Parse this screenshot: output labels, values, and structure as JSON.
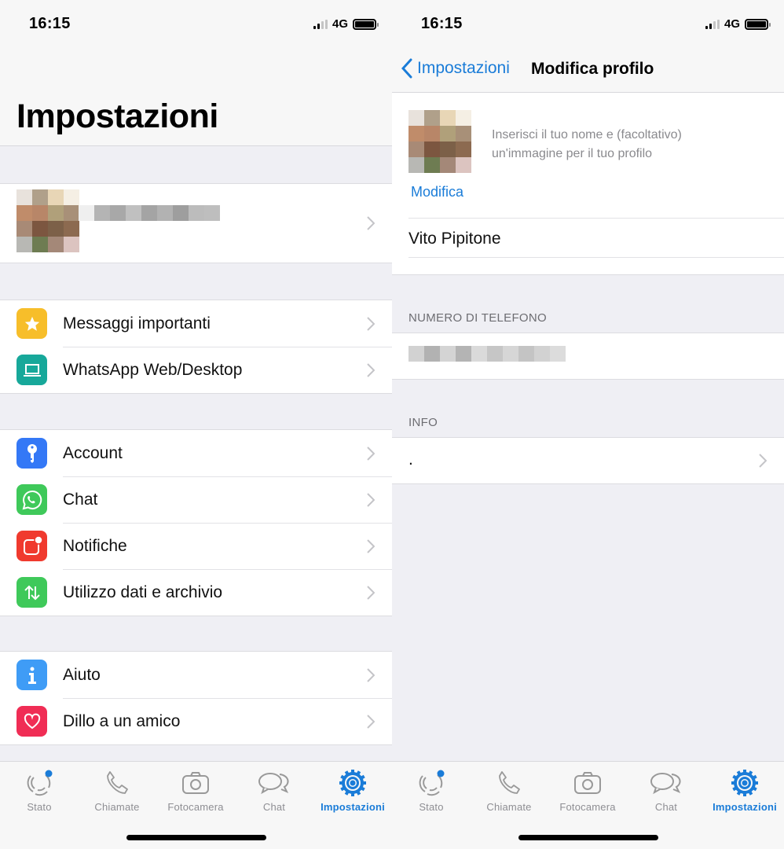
{
  "status_bar": {
    "time": "16:15",
    "network": "4G",
    "signal_bars_active": 2,
    "signal_bars_total": 4,
    "battery_level": 1.0
  },
  "left_screen": {
    "title": "Impostazioni",
    "profile": {
      "avatar": "pixelated-avatar",
      "name": "pixelated-name",
      "chevron": "chevron-right-icon"
    },
    "groups": [
      [
        {
          "label": "Messaggi importanti",
          "icon": "star-icon",
          "color": "#f7be2a"
        },
        {
          "label": "WhatsApp Web/Desktop",
          "icon": "laptop-icon",
          "color": "#17a89a"
        }
      ],
      [
        {
          "label": "Account",
          "icon": "key-icon",
          "color": "#3478f6"
        },
        {
          "label": "Chat",
          "icon": "whatsapp-icon",
          "color": "#3fc95a"
        },
        {
          "label": "Notifiche",
          "icon": "notification-icon",
          "color": "#f03a2e"
        },
        {
          "label": "Utilizzo dati e archivio",
          "icon": "data-arrows-icon",
          "color": "#3fc95a"
        }
      ],
      [
        {
          "label": "Aiuto",
          "icon": "info-icon",
          "color": "#3f9cf6"
        },
        {
          "label": "Dillo a un amico",
          "icon": "heart-icon",
          "color": "#f02d55"
        }
      ]
    ]
  },
  "right_screen": {
    "back_label": "Impostazioni",
    "title": "Modifica profilo",
    "hint_line1": "Inserisci il tuo nome e (facoltativo)",
    "hint_line2": "un'immagine per il tuo profilo",
    "edit_label": "Modifica",
    "name_value": "Vito Pipitone",
    "phone_section": "NUMERO DI TELEFONO",
    "phone_value": "pixelated-phone",
    "info_section": "INFO",
    "info_value": "."
  },
  "tab_bar": {
    "tabs": [
      {
        "label": "Stato",
        "icon": "status-icon",
        "active": false
      },
      {
        "label": "Chiamate",
        "icon": "phone-icon",
        "active": false
      },
      {
        "label": "Fotocamera",
        "icon": "camera-icon",
        "active": false
      },
      {
        "label": "Chat",
        "icon": "chat-bubbles-icon",
        "active": false
      },
      {
        "label": "Impostazioni",
        "icon": "settings-gear-icon",
        "active": true
      }
    ],
    "active_color": "#1a7cd8",
    "inactive_color": "#8e8e93"
  },
  "avatar_pixels": [
    "#e8e2dc",
    "#b0a08a",
    "#e8d6b6",
    "#f5efe4",
    "#c08c6a",
    "#b88668",
    "#b0a07a",
    "#a89078",
    "#a88a76",
    "#7c5640",
    "#7c6048",
    "#8c6a50",
    "#b8b8b4",
    "#6e7c52",
    "#a48878",
    "#dcc4c0"
  ],
  "colors": {
    "accent": "#1a7cd8",
    "background": "#efeff4"
  }
}
